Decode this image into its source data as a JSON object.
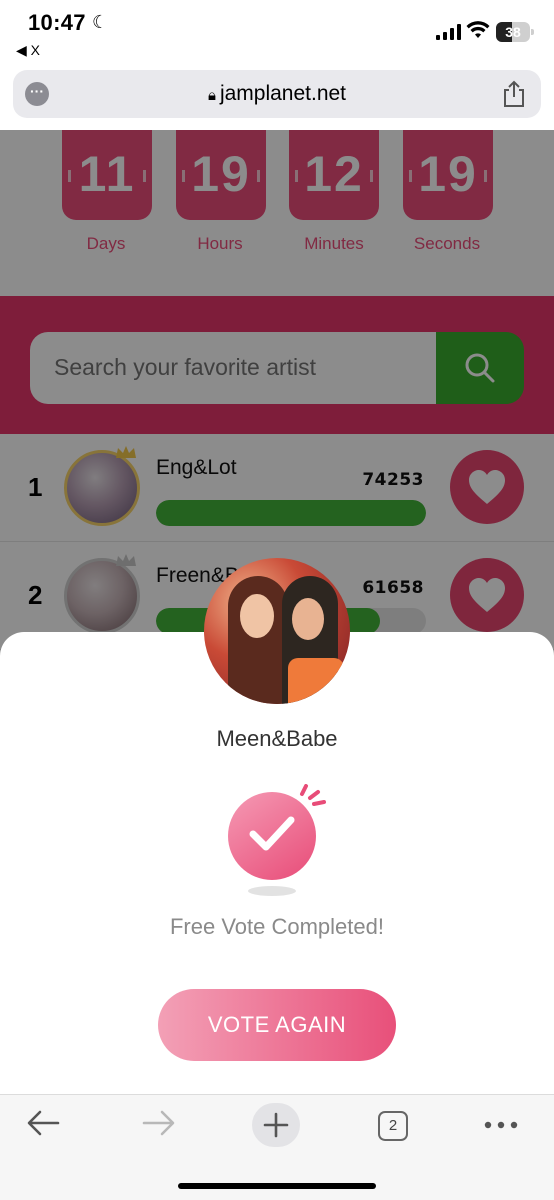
{
  "status_bar": {
    "time": "10:47",
    "back_app": "◀ X",
    "battery": "38"
  },
  "browser": {
    "url": "jamplanet.net"
  },
  "countdown": {
    "units": [
      {
        "value": "11",
        "label": "Days"
      },
      {
        "value": "19",
        "label": "Hours"
      },
      {
        "value": "12",
        "label": "Minutes"
      },
      {
        "value": "19",
        "label": "Seconds"
      }
    ]
  },
  "search": {
    "placeholder": "Search your favorite artist"
  },
  "leaderboard": {
    "rows": [
      {
        "rank": "1",
        "name": "Eng&Lot",
        "votes": "74253",
        "progress": 1.0
      },
      {
        "rank": "2",
        "name": "Freen&B",
        "votes": "61658",
        "progress": 0.83
      }
    ]
  },
  "modal": {
    "artist_name": "Meen&Babe",
    "status_message": "Free Vote Completed!",
    "action_label": "VOTE AGAIN"
  },
  "toolbar": {
    "tab_count": "2"
  },
  "colors": {
    "brand_pink": "#e8456f",
    "search_green": "#3aac2e",
    "progress_green": "#43b33a"
  }
}
